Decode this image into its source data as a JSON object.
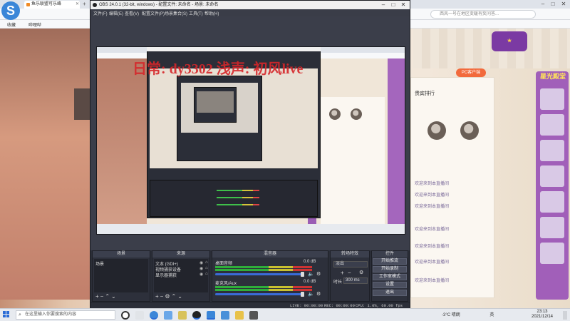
{
  "browser": {
    "tab_title": "鱼乐联盟可乐峰",
    "bookmarks": [
      "收藏",
      "哔哩哔"
    ],
    "search_placeholder": "西风一号在地区变暖有奖问答..."
  },
  "page": {
    "pc_button": "PC客户端",
    "sidebar_title": "星光殿堂",
    "chat_title": "贵宾排行",
    "chat_lines": [
      "欢迎来到本直播间",
      "欢迎来到本直播间",
      "欢迎来到本直播间",
      "欢迎来到本直播间",
      "欢迎来到本直播间",
      "欢迎来到本直播间",
      "欢迎来到本直播间"
    ]
  },
  "obs": {
    "title": "OBS 24.0.1 (32-bit, windows) - 配置文件: 未命名 - 场景: 未命名",
    "menu": [
      "文件(F)",
      "编辑(E)",
      "查看(V)",
      "配置文件(P)",
      "场景集合(S)",
      "工具(T)",
      "帮助(H)"
    ],
    "watermark": "日常: dy3302 浅声: 初风live",
    "scenes": {
      "title": "场景",
      "items": [
        "场景"
      ]
    },
    "sources": {
      "title": "来源",
      "items": [
        "文本 (GDI+)",
        "视频捕获设备",
        "显示器捕获"
      ]
    },
    "mixer": {
      "title": "混音器",
      "tracks": [
        {
          "name": "桌面音频",
          "db": "0.0 dB"
        },
        {
          "name": "麦克风/Aux",
          "db": "0.0 dB"
        }
      ]
    },
    "transitions": {
      "title": "转场特效",
      "selected": "淡出",
      "duration_label": "时长",
      "duration_value": "300 ms"
    },
    "controls": {
      "title": "控件",
      "buttons": [
        "开始推流",
        "开始录制",
        "工作室模式",
        "设置",
        "退出"
      ]
    },
    "status": {
      "live": "LIVE: 00:00:00",
      "rec": "REC: 00:00:00",
      "cpu": "CPU: 1.0%, 60.00 fps"
    }
  },
  "taskbar": {
    "search_placeholder": "在这里输入你要搜索的内容",
    "weather": "-3°C 晴朗",
    "lang": "英",
    "time": "23:13",
    "date": "2021/12/14"
  }
}
